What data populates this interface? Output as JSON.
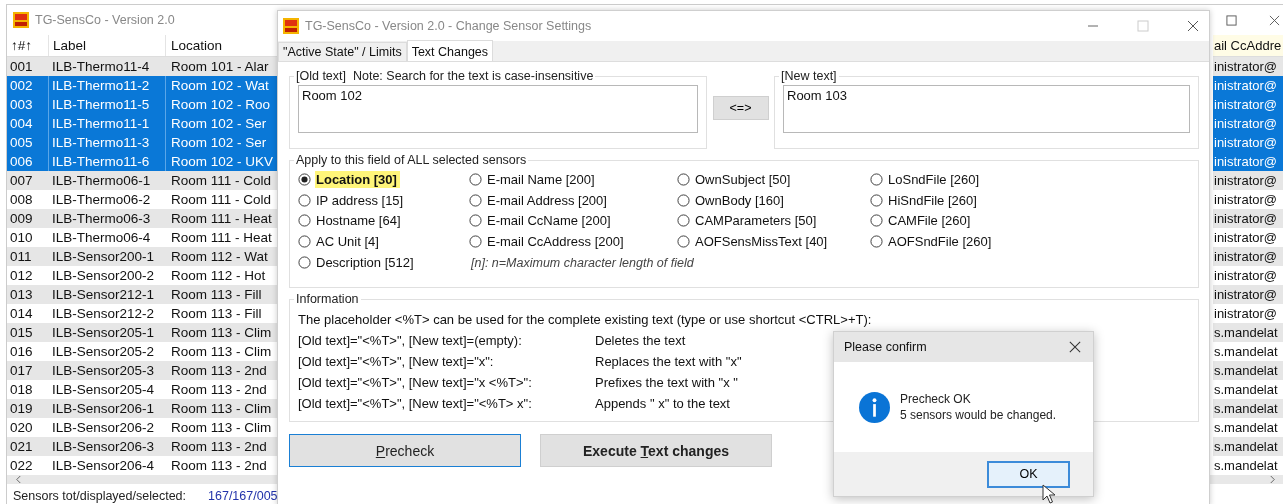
{
  "main_window": {
    "title": "TG-SensCo - Version 2.0",
    "table": {
      "columns": [
        "↑#↑",
        "Label",
        "Location"
      ],
      "right_column": "ail CcAddre",
      "rows": [
        {
          "no": "001",
          "label": "ILB-Thermo11-4",
          "location": "Room 101 - Alar",
          "cc": "inistrator@",
          "selected": false
        },
        {
          "no": "002",
          "label": "ILB-Thermo11-2",
          "location": "Room 102 - Wat",
          "cc": "inistrator@",
          "selected": true
        },
        {
          "no": "003",
          "label": "ILB-Thermo11-5",
          "location": "Room 102 - Roo",
          "cc": "inistrator@",
          "selected": true
        },
        {
          "no": "004",
          "label": "ILB-Thermo11-1",
          "location": "Room 102 - Ser",
          "cc": "inistrator@",
          "selected": true
        },
        {
          "no": "005",
          "label": "ILB-Thermo11-3",
          "location": "Room 102 - Ser",
          "cc": "inistrator@",
          "selected": true
        },
        {
          "no": "006",
          "label": "ILB-Thermo11-6",
          "location": "Room 102 - UKV",
          "cc": "inistrator@",
          "selected": true
        },
        {
          "no": "007",
          "label": "ILB-Thermo06-1",
          "location": "Room 111 - Cold",
          "cc": "inistrator@",
          "selected": false
        },
        {
          "no": "008",
          "label": "ILB-Thermo06-2",
          "location": "Room 111 - Cold",
          "cc": "inistrator@",
          "selected": false
        },
        {
          "no": "009",
          "label": "ILB-Thermo06-3",
          "location": "Room 111 - Heat",
          "cc": "inistrator@",
          "selected": false
        },
        {
          "no": "010",
          "label": "ILB-Thermo06-4",
          "location": "Room 111 - Heat",
          "cc": "inistrator@",
          "selected": false
        },
        {
          "no": "011",
          "label": "ILB-Sensor200-1",
          "location": "Room 112 - Wat",
          "cc": "inistrator@",
          "selected": false
        },
        {
          "no": "012",
          "label": "ILB-Sensor200-2",
          "location": "Room 112 - Hot",
          "cc": "inistrator@",
          "selected": false
        },
        {
          "no": "013",
          "label": "ILB-Sensor212-1",
          "location": "Room 113 - Fill",
          "cc": "inistrator@",
          "selected": false
        },
        {
          "no": "014",
          "label": "ILB-Sensor212-2",
          "location": "Room 113 - Fill",
          "cc": "inistrator@",
          "selected": false
        },
        {
          "no": "015",
          "label": "ILB-Sensor205-1",
          "location": "Room 113 - Clim",
          "cc": "s.mandelat",
          "selected": false
        },
        {
          "no": "016",
          "label": "ILB-Sensor205-2",
          "location": "Room 113 - Clim",
          "cc": "s.mandelat",
          "selected": false
        },
        {
          "no": "017",
          "label": "ILB-Sensor205-3",
          "location": "Room 113 - 2nd",
          "cc": "s.mandelat",
          "selected": false
        },
        {
          "no": "018",
          "label": "ILB-Sensor205-4",
          "location": "Room 113 - 2nd",
          "cc": "s.mandelat",
          "selected": false
        },
        {
          "no": "019",
          "label": "ILB-Sensor206-1",
          "location": "Room 113 - Clim",
          "cc": "s.mandelat",
          "selected": false
        },
        {
          "no": "020",
          "label": "ILB-Sensor206-2",
          "location": "Room 113 - Clim",
          "cc": "s.mandelat",
          "selected": false
        },
        {
          "no": "021",
          "label": "ILB-Sensor206-3",
          "location": "Room 113 - 2nd",
          "cc": "s.mandelat",
          "selected": false
        },
        {
          "no": "022",
          "label": "ILB-Sensor206-4",
          "location": "Room 113 - 2nd",
          "cc": "s.mandelat",
          "selected": false
        }
      ]
    },
    "status_bar": {
      "label": "Sensors tot/displayed/selected:",
      "value": "167/167/005"
    }
  },
  "dialog": {
    "title": "TG-SensCo - Version 2.0 - Change Sensor Settings",
    "tabs": [
      {
        "label": "\"Active State\" / Limits",
        "selected": false
      },
      {
        "label": "Text Changes",
        "selected": true
      }
    ],
    "old_text": {
      "legend": "[Old text]  Note: Search for the text is case-insensitive",
      "value": "Room 102"
    },
    "swap_button": "<=>",
    "new_text": {
      "legend": "[New text]",
      "value": "Room 103"
    },
    "apply": {
      "legend": "Apply to this field of ALL selected sensors",
      "columns": [
        [
          {
            "label": "Location [30]",
            "selected": true
          },
          {
            "label": "IP address [15]",
            "selected": false
          },
          {
            "label": "Hostname [64]",
            "selected": false
          },
          {
            "label": "AC Unit [4]",
            "selected": false
          },
          {
            "label": "Description [512]",
            "selected": false
          }
        ],
        [
          {
            "label": "E-mail Name [200]",
            "selected": false
          },
          {
            "label": "E-mail Address [200]",
            "selected": false
          },
          {
            "label": "E-mail CcName [200]",
            "selected": false
          },
          {
            "label": "E-mail CcAddress [200]",
            "selected": false
          }
        ],
        [
          {
            "label": "OwnSubject [50]",
            "selected": false
          },
          {
            "label": "OwnBody [160]",
            "selected": false
          },
          {
            "label": "CAMParameters [50]",
            "selected": false
          },
          {
            "label": "AOFSensMissText [40]",
            "selected": false
          }
        ],
        [
          {
            "label": "LoSndFile [260]",
            "selected": false
          },
          {
            "label": "HiSndFile [260]",
            "selected": false
          },
          {
            "label": "CAMFile [260]",
            "selected": false
          },
          {
            "label": "AOFSndFile [260]",
            "selected": false
          }
        ]
      ],
      "note": "[n]: n=Maximum character length of field"
    },
    "information": {
      "legend": "Information",
      "intro": "The placeholder <%T> can be used for the complete existing text (type or use shortcut <CTRL>+T):",
      "lines": [
        {
          "condition": "[Old text]=\"<%T>\", [New text]=(empty):",
          "effect": "Deletes the text"
        },
        {
          "condition": "[Old text]=\"<%T>\", [New text]=\"x\":",
          "effect": "Replaces the text with \"x\""
        },
        {
          "condition": "[Old text]=\"<%T>\", [New text]=\"x <%T>\":",
          "effect": "Prefixes the text with \"x \""
        },
        {
          "condition": "[Old text]=\"<%T>\", [New text]=\"<%T> x\":",
          "effect": "Appends \" x\" to the text"
        }
      ]
    },
    "buttons": [
      {
        "access_key": "P",
        "after": "recheck",
        "focused": true,
        "bold": false
      },
      {
        "before": "Execute ",
        "access_key": "T",
        "after": "ext changes",
        "focused": false,
        "bold": true
      }
    ]
  },
  "confirm": {
    "title": "Please confirm",
    "lines": [
      "Precheck OK",
      "5 sensors would be changed."
    ],
    "button": {
      "label": "OK",
      "focused": true
    }
  }
}
